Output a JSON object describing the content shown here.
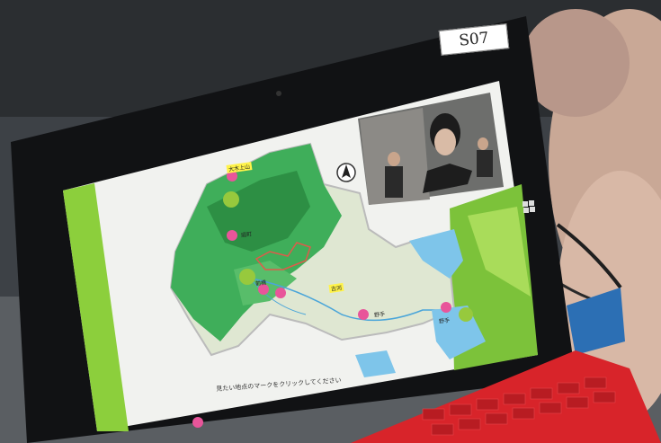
{
  "photo": {
    "description_tags": [
      "tablet",
      "video-call",
      "map",
      "red-keyboard"
    ]
  },
  "sticker": {
    "label": "S07"
  },
  "map_slide": {
    "places": [
      {
        "name": "大木上山"
      },
      {
        "name": "庭町"
      },
      {
        "name": "前橋"
      },
      {
        "name": "古河"
      },
      {
        "name": "野手"
      },
      {
        "name": "野手"
      }
    ],
    "instruction": "見たい地点のマークをクリックしてください"
  },
  "colors": {
    "map_green": "#3fae5a",
    "marker_pink": "#e8559a",
    "slide_accent": "#8ccf3c",
    "keyboard_red": "#d8242a"
  }
}
